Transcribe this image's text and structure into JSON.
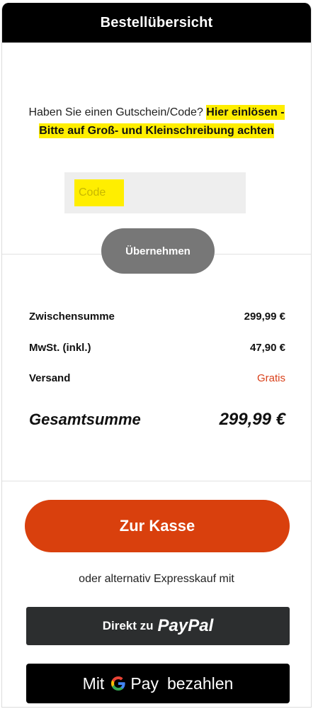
{
  "header": {
    "title": "Bestellübersicht"
  },
  "coupon": {
    "prompt": "Haben Sie einen Gutschein/Code?",
    "highlight": "Hier einlösen - Bitte auf Groß- und Kleinschreibung achten",
    "placeholder": "Code",
    "apply_label": "Übernehmen"
  },
  "totals": {
    "subtotal_label": "Zwischensumme",
    "subtotal_value": "299,99 €",
    "tax_label": "MwSt. (inkl.)",
    "tax_value": "47,90 €",
    "shipping_label": "Versand",
    "shipping_value": "Gratis",
    "grand_label": "Gesamtsumme",
    "grand_value": "299,99 €"
  },
  "checkout": {
    "label": "Zur Kasse"
  },
  "express": {
    "intro": "oder alternativ Expresskauf mit",
    "paypal_prefix": "Direkt zu",
    "paypal_brand": "PayPal",
    "gpay_prefix": "Mit",
    "gpay_brand": "Pay",
    "gpay_suffix": "bezahlen"
  },
  "colors": {
    "highlight": "#ffee00",
    "checkout": "#d9400d",
    "free_shipping": "#d9401a"
  }
}
